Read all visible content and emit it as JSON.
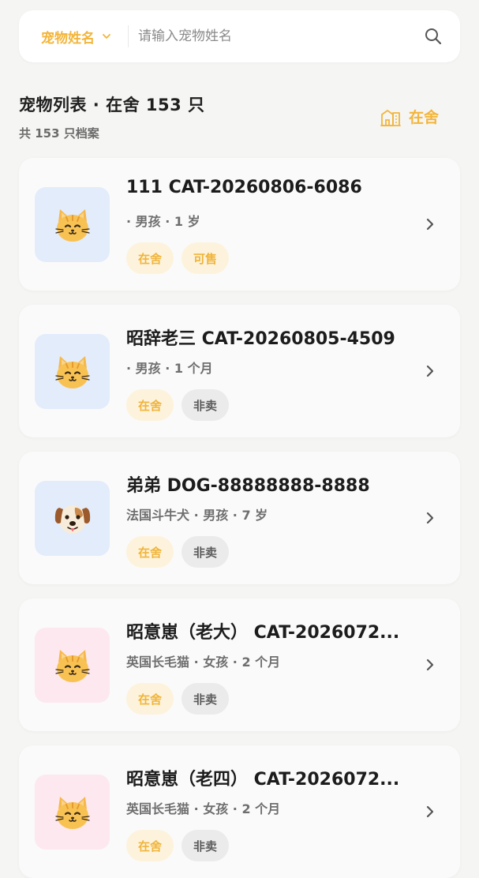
{
  "search": {
    "type_label": "宠物姓名",
    "placeholder": "请输入宠物姓名",
    "value": ""
  },
  "list": {
    "title": "宠物列表 · 在舍 153 只",
    "subtitle": "共 153 只档案",
    "status_filter": "在舍"
  },
  "colors": {
    "accent": "#f3b53a",
    "avatar_blue": "#e2ecfb",
    "avatar_pink": "#fde8ef"
  },
  "pets": [
    {
      "title": "111  CAT-20260806-6086",
      "meta": "· 男孩 · 1 岁",
      "avatar_icon": "cat-face-icon",
      "avatar_bg": "blue",
      "tags": [
        {
          "label": "在舍",
          "style": "yellow"
        },
        {
          "label": "可售",
          "style": "yellow"
        }
      ]
    },
    {
      "title": "昭辞老三  CAT-20260805-4509",
      "meta": "· 男孩 · 1 个月",
      "avatar_icon": "cat-face-icon",
      "avatar_bg": "blue",
      "tags": [
        {
          "label": "在舍",
          "style": "yellow"
        },
        {
          "label": "非卖",
          "style": "gray"
        }
      ]
    },
    {
      "title": "弟弟  DOG-88888888-8888",
      "meta": "法国斗牛犬 · 男孩 · 7 岁",
      "avatar_icon": "dog-face-icon",
      "avatar_bg": "blue",
      "tags": [
        {
          "label": "在舍",
          "style": "yellow"
        },
        {
          "label": "非卖",
          "style": "gray"
        }
      ]
    },
    {
      "title": "昭意崽（老大） CAT-2026072...",
      "meta": "英国长毛猫 · 女孩 · 2 个月",
      "avatar_icon": "cat-face-icon",
      "avatar_bg": "pink",
      "tags": [
        {
          "label": "在舍",
          "style": "yellow"
        },
        {
          "label": "非卖",
          "style": "gray"
        }
      ]
    },
    {
      "title": "昭意崽（老四） CAT-2026072...",
      "meta": "英国长毛猫 · 女孩 · 2 个月",
      "avatar_icon": "cat-face-icon",
      "avatar_bg": "pink",
      "tags": [
        {
          "label": "在舍",
          "style": "yellow"
        },
        {
          "label": "非卖",
          "style": "gray"
        }
      ]
    }
  ]
}
